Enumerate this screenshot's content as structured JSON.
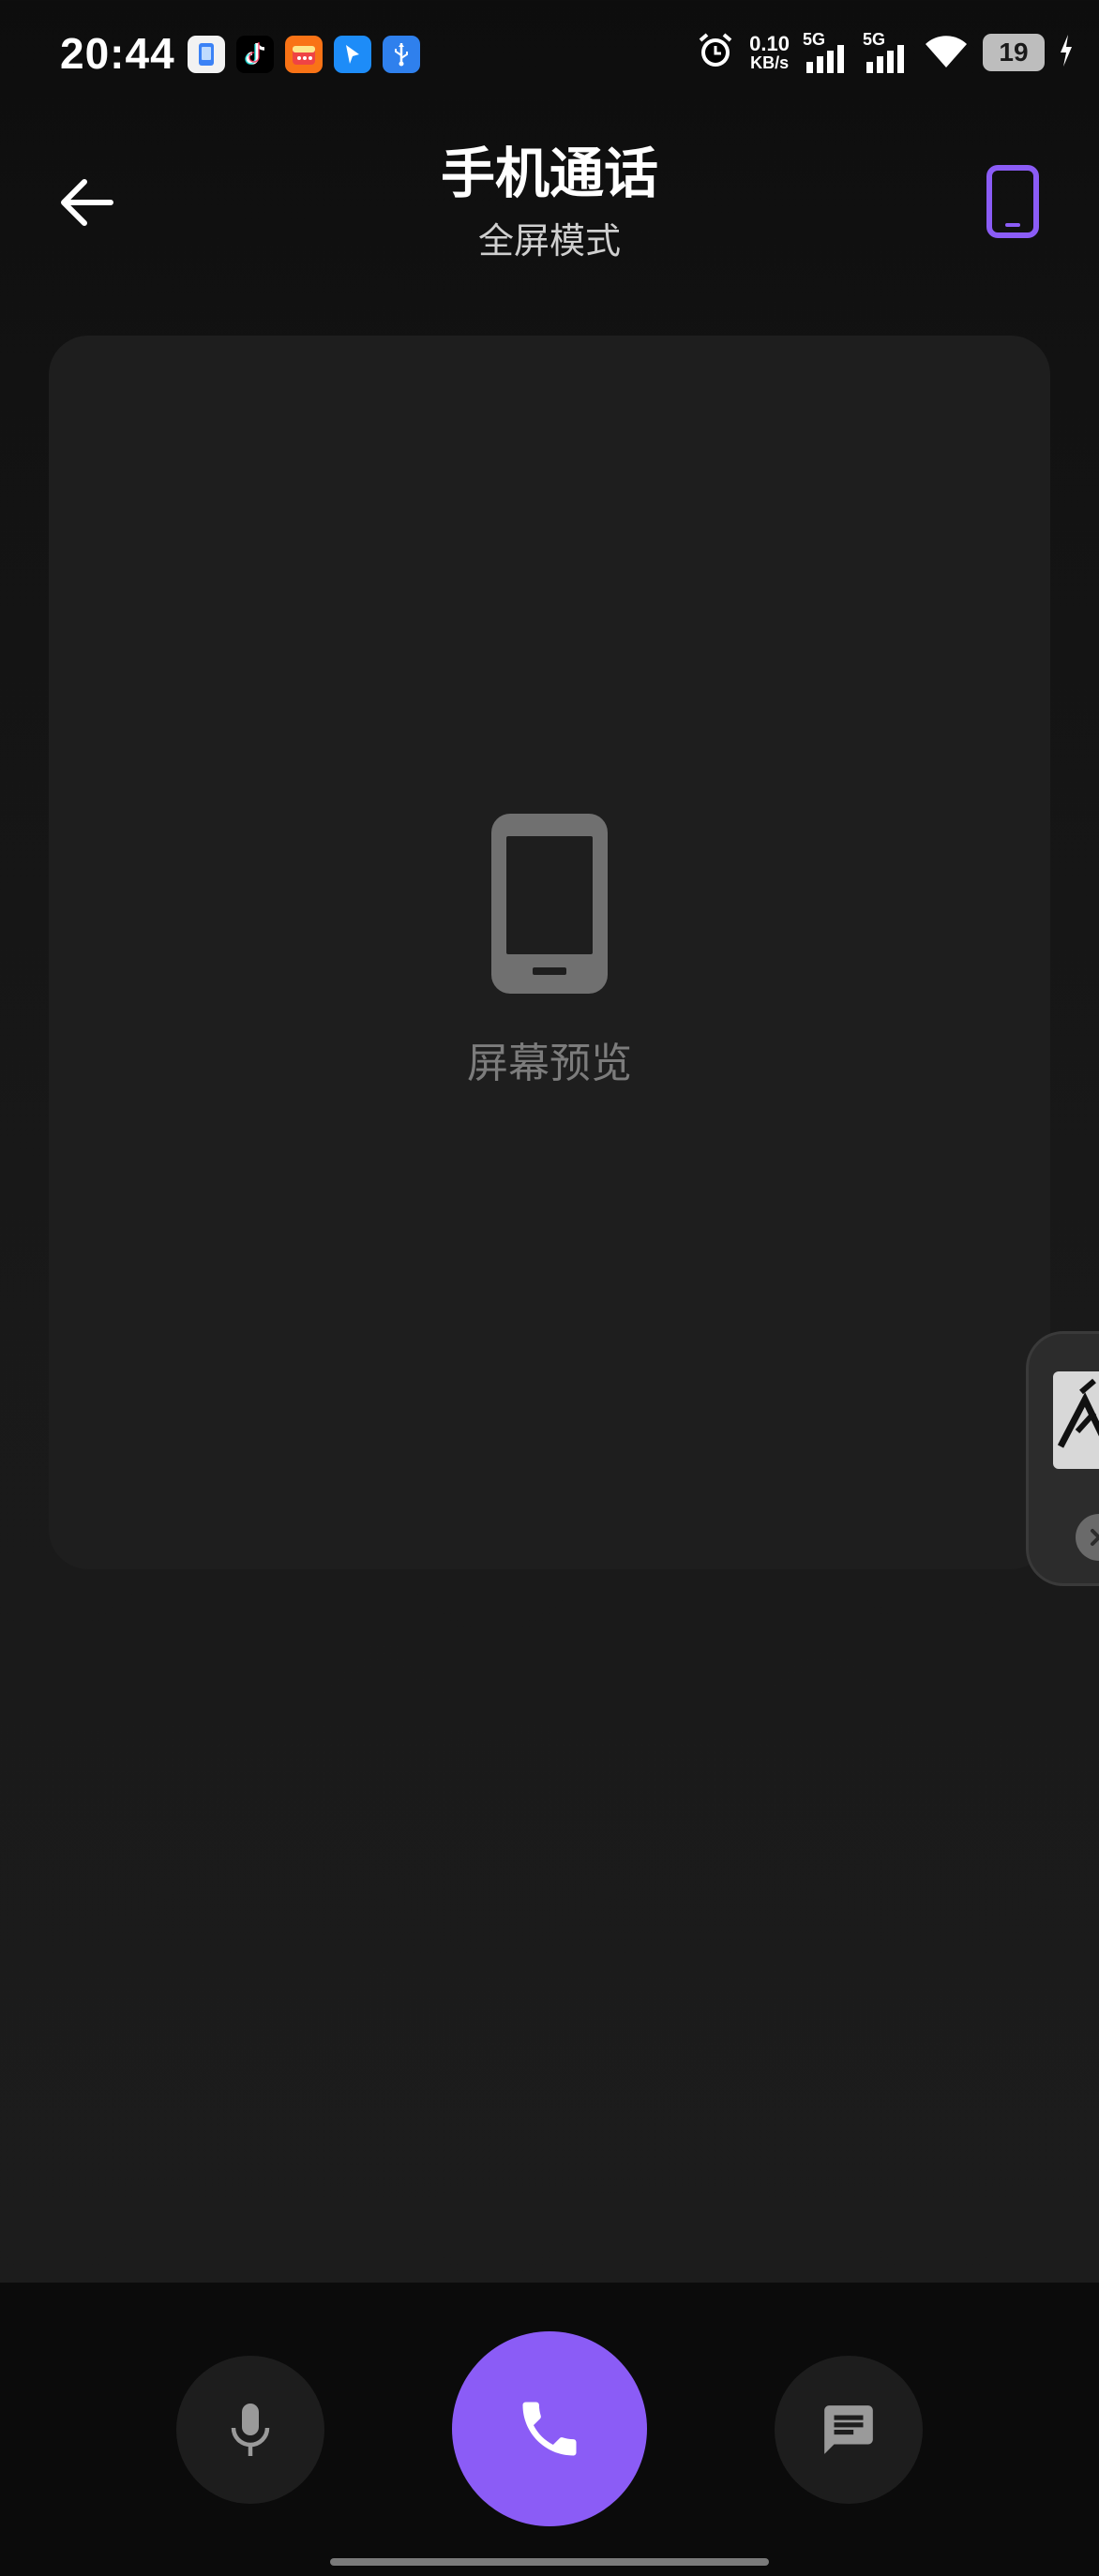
{
  "status_bar": {
    "time": "20:44",
    "net_speed_value": "0.10",
    "net_speed_unit": "KB/s",
    "sim1_tag": "5G",
    "sim2_tag": "5G",
    "battery_level": "19",
    "app_icons": [
      "phone-clone-app-icon",
      "tiktok-icon",
      "calendar-app-icon",
      "maps-app-icon",
      "usb-icon"
    ]
  },
  "header": {
    "title": "手机通话",
    "subtitle": "全屏模式",
    "accent_color": "#8b5cf6"
  },
  "preview": {
    "label": "屏幕预览",
    "icon": "phone-icon"
  },
  "controls": {
    "mic_icon": "microphone-icon",
    "call_icon": "phone-call-icon",
    "message_icon": "message-icon",
    "call_color": "#8b5cf6"
  }
}
